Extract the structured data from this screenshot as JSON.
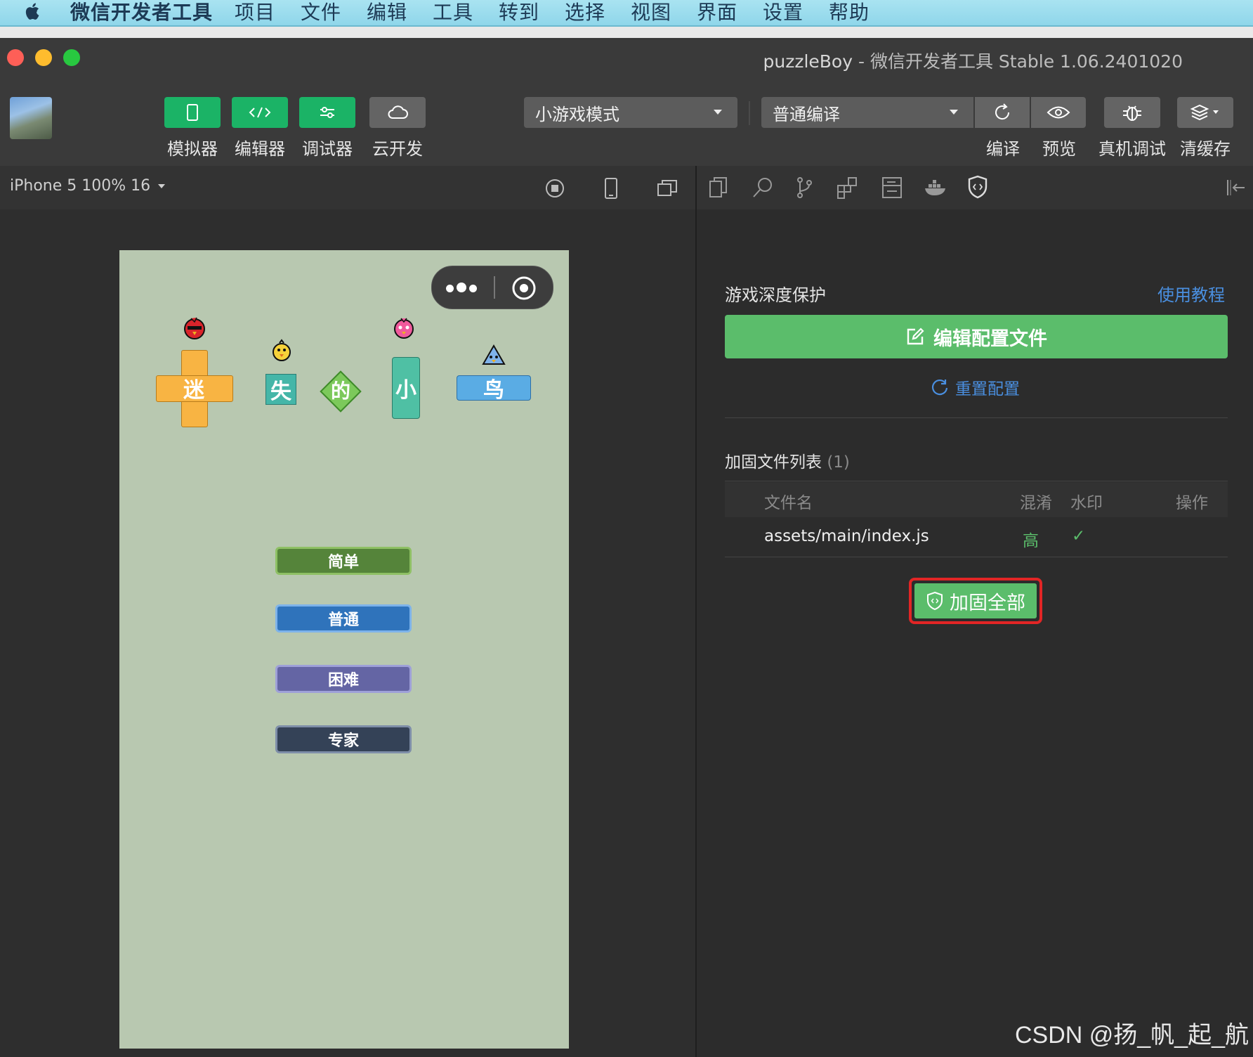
{
  "menubar": {
    "app_name": "微信开发者工具",
    "items": [
      "项目",
      "文件",
      "编辑",
      "工具",
      "转到",
      "选择",
      "视图",
      "界面",
      "设置",
      "帮助"
    ]
  },
  "window": {
    "project": "puzzleBoy",
    "separator": " - ",
    "app_version": "微信开发者工具 Stable 1.06.2401020"
  },
  "toolbar": {
    "simulator": "模拟器",
    "editor": "编辑器",
    "debugger": "调试器",
    "cloud": "云开发",
    "mode": "小游戏模式",
    "compile_mode": "普通编译",
    "compile": "编译",
    "preview": "预览",
    "remote_debug": "真机调试",
    "clear_cache": "清缓存"
  },
  "simulator": {
    "device": "iPhone 5 100% 16",
    "title_chars": [
      "迷",
      "失",
      "的",
      "小",
      "鸟"
    ],
    "buttons": [
      "简单",
      "普通",
      "困难",
      "专家"
    ]
  },
  "panel": {
    "section_title": "游戏深度保护",
    "tutorial_link": "使用教程",
    "edit_config": "编辑配置文件",
    "reset_config": "重置配置",
    "list_title": "加固文件列表",
    "list_count": "(1)",
    "columns": {
      "filename": "文件名",
      "obfuscate": "混淆",
      "watermark": "水印",
      "action": "操作"
    },
    "files": [
      {
        "name": "assets/main/index.js",
        "obfuscate": "高",
        "watermark": "✓"
      }
    ],
    "harden_all": "加固全部"
  },
  "watermark_text": "CSDN @扬_帆_起_航",
  "colors": {
    "accent_green": "#1bb366",
    "button_green": "#5bbd6b",
    "link_blue": "#4a8fe0",
    "highlight_red": "#e22525"
  }
}
